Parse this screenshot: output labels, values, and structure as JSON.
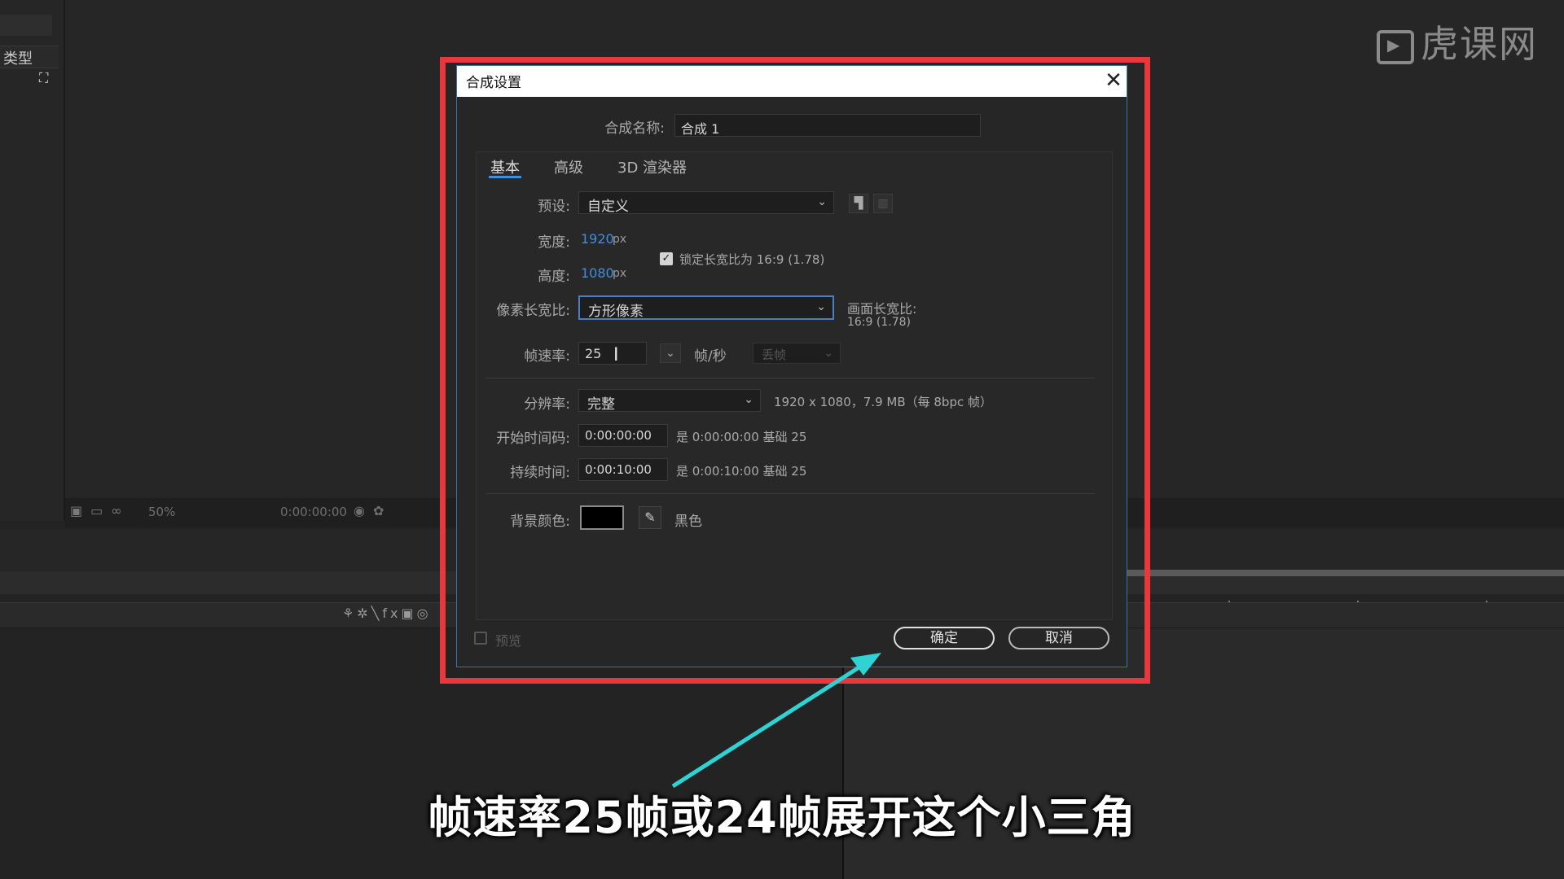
{
  "watermark": "虎课网",
  "left_panel": {
    "type_label": "类型"
  },
  "viewer_toolbar": {
    "zoom": "50%",
    "timecode": "0:00:00:00"
  },
  "dialog": {
    "title": "合成设置",
    "close": "✕",
    "comp_name_label": "合成名称:",
    "comp_name_value": "合成 1",
    "tabs": [
      {
        "label": "基本"
      },
      {
        "label": "高级"
      },
      {
        "label": "3D 渲染器"
      }
    ],
    "preset_label": "预设:",
    "preset_value": "自定义",
    "width_label": "宽度:",
    "width_value": "1920",
    "height_label": "高度:",
    "height_value": "1080",
    "unit_px": "px",
    "lock_aspect_label": "锁定长宽比为 16:9 (1.78)",
    "pixel_aspect_label": "像素长宽比:",
    "pixel_aspect_value": "方形像素",
    "frame_aspect_label": "画面长宽比:",
    "frame_aspect_value": "16:9 (1.78)",
    "frame_rate_label": "帧速率:",
    "frame_rate_value": "25",
    "fps_unit": "帧/秒",
    "drop_frame": "丢帧",
    "resolution_label": "分辨率:",
    "resolution_value": "完整",
    "resolution_info": "1920 x 1080，7.9 MB（每 8bpc 帧）",
    "start_tc_label": "开始时间码:",
    "start_tc_value": "0:00:00:00",
    "start_tc_info": "是 0:00:00:00  基础 25",
    "duration_label": "持续时间:",
    "duration_value": "0:00:10:00",
    "duration_info": "是 0:00:10:00  基础 25",
    "bg_color_label": "背景颜色:",
    "bg_color_name": "黑色",
    "bg_color_hex": "#000000",
    "preview_label": "预览",
    "ok_button": "确定",
    "cancel_button": "取消"
  },
  "annotation": {
    "subtitle": "帧速率25帧或24帧展开这个小三角",
    "highlight_color": "#e8383d",
    "arrow_color": "#2fd3d3"
  }
}
